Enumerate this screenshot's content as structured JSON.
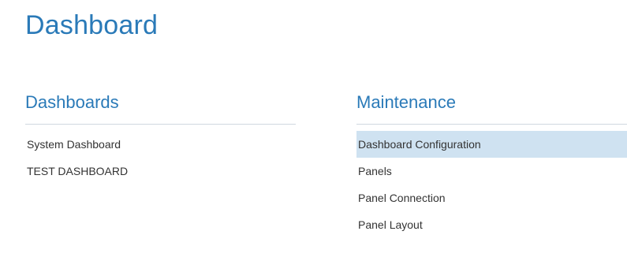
{
  "page": {
    "title": "Dashboard"
  },
  "sections": {
    "dashboards": {
      "heading": "Dashboards",
      "items": [
        {
          "label": "System Dashboard"
        },
        {
          "label": "TEST DASHBOARD"
        }
      ]
    },
    "maintenance": {
      "heading": "Maintenance",
      "selected_index": 0,
      "items": [
        {
          "label": "Dashboard Configuration"
        },
        {
          "label": "Panels"
        },
        {
          "label": "Panel Connection"
        },
        {
          "label": "Panel Layout"
        }
      ]
    }
  },
  "colors": {
    "heading": "#2a7ab8",
    "selected_background": "#cfe2f1",
    "divider": "#cfd8e0",
    "text": "#333333"
  }
}
